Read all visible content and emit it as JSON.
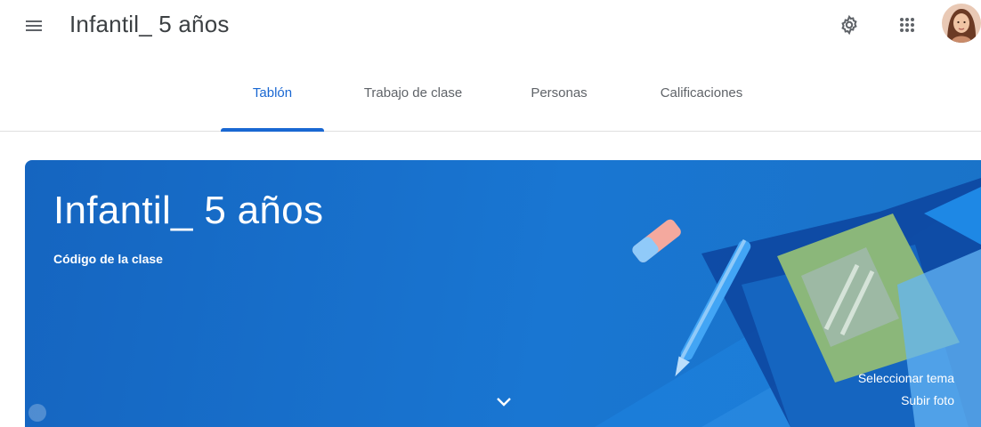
{
  "header": {
    "title": "Infantil_ 5 años",
    "icons": [
      "menu-icon",
      "gear-icon",
      "apps-grid-icon",
      "avatar"
    ]
  },
  "tabs": [
    {
      "label": "Tablón",
      "active": true
    },
    {
      "label": "Trabajo de clase",
      "active": false
    },
    {
      "label": "Personas",
      "active": false
    },
    {
      "label": "Calificaciones",
      "active": false
    }
  ],
  "banner": {
    "title": "Infantil_ 5 años",
    "class_code_label": "Código de la clase",
    "select_theme": "Seleccionar tema",
    "upload_photo": "Subir foto",
    "background_color": "#1976d2"
  },
  "colors": {
    "accent": "#1967d2",
    "title_text": "#3c4043",
    "tab_text": "#5f6368"
  }
}
